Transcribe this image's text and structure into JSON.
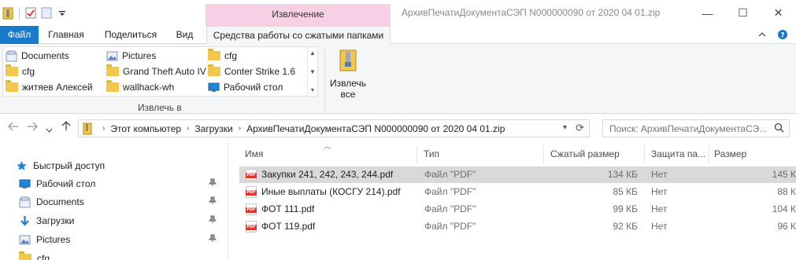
{
  "window": {
    "title": "АрхивПечатиДокументаСЭП N000000090 от 2020 04 01.zip",
    "context_group": "Извлечение",
    "minimize": "—",
    "maximize": "☐",
    "close": "✕"
  },
  "ribbon": {
    "tabs": {
      "file": "Файл",
      "home": "Главная",
      "share": "Поделиться",
      "view": "Вид",
      "compressed_tools": "Средства работы со сжатыми папками"
    },
    "gallery": [
      {
        "label": "Documents",
        "icon": "documents-icon"
      },
      {
        "label": "Pictures",
        "icon": "pictures-icon"
      },
      {
        "label": "cfg",
        "icon": "folder-icon"
      },
      {
        "label": "cfg",
        "icon": "folder-icon"
      },
      {
        "label": "Grand Theft Auto IV",
        "icon": "folder-icon"
      },
      {
        "label": "Conter Strike 1.6",
        "icon": "folder-icon"
      },
      {
        "label": "житяев Алексей",
        "icon": "folder-icon"
      },
      {
        "label": "wallhack-wh",
        "icon": "folder-icon"
      },
      {
        "label": "Рабочий стол",
        "icon": "desktop-icon"
      }
    ],
    "group_label": "Извлечь в",
    "extract_all": {
      "line1": "Извлечь",
      "line2": "все"
    }
  },
  "address": {
    "crumbs": [
      "Этот компьютер",
      "Загрузки",
      "АрхивПечатиДокументаСЭП N000000090 от 2020 04 01.zip"
    ]
  },
  "search": {
    "placeholder": "Поиск: АрхивПечатиДокументаСЭ..."
  },
  "navpane": {
    "items": [
      {
        "label": "Быстрый доступ",
        "icon": "star-icon",
        "pinned": false
      },
      {
        "label": "Рабочий стол",
        "icon": "desktop-icon",
        "pinned": true
      },
      {
        "label": "Documents",
        "icon": "documents-icon",
        "pinned": true
      },
      {
        "label": "Загрузки",
        "icon": "download-icon",
        "pinned": true
      },
      {
        "label": "Pictures",
        "icon": "pictures-icon",
        "pinned": true
      },
      {
        "label": "cfg",
        "icon": "folder-icon",
        "pinned": false
      }
    ]
  },
  "columns": {
    "name": "Имя",
    "type": "Тип",
    "compressed_size": "Сжатый размер",
    "protection": "Защита па...",
    "size": "Размер"
  },
  "files": [
    {
      "name": "Закупки 241, 242, 243, 244.pdf",
      "type": "Файл \"PDF\"",
      "compressed": "134 КБ",
      "protection": "Нет",
      "size": "145 К",
      "selected": true
    },
    {
      "name": "Иные выплаты (КОСГУ 214).pdf",
      "type": "Файл \"PDF\"",
      "compressed": "85 КБ",
      "protection": "Нет",
      "size": "88 К",
      "selected": false
    },
    {
      "name": "ФОТ 111.pdf",
      "type": "Файл \"PDF\"",
      "compressed": "99 КБ",
      "protection": "Нет",
      "size": "104 К",
      "selected": false
    },
    {
      "name": "ФОТ 119.pdf",
      "type": "Файл \"PDF\"",
      "compressed": "92 КБ",
      "protection": "Нет",
      "size": "96 К",
      "selected": false
    }
  ],
  "colors": {
    "file_tab": "#1979ca",
    "context_tab": "#f8d0e6",
    "selected_row": "#d9d9d9"
  }
}
